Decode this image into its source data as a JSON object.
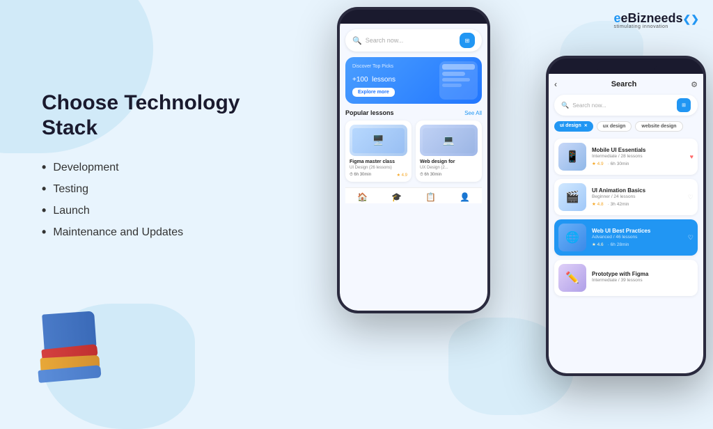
{
  "logo": {
    "brand": "eBizneeds",
    "subtitle": "stimulating innovation",
    "suffix": "❮❯"
  },
  "hero": {
    "title": "Choose Technology Stack"
  },
  "bullets": [
    {
      "text": "Development"
    },
    {
      "text": "Testing"
    },
    {
      "text": "Launch"
    },
    {
      "text": "Maintenance and Updates"
    }
  ],
  "phone1": {
    "search_placeholder": "Search now...",
    "hero_subtitle": "Discover Top Picks",
    "hero_count": "+100",
    "hero_count_label": "lessons",
    "hero_btn": "Explore more",
    "section_title": "Popular lessons",
    "see_all": "See All",
    "card1": {
      "title": "Figma master class",
      "subtitle": "UI Design (26 lessons)",
      "time": "6h 30min",
      "rating": "4.9"
    },
    "card2": {
      "title": "Web design for",
      "subtitle": "UX Design (2...",
      "time": "6h 30min",
      "rating": ""
    }
  },
  "phone2": {
    "header_title": "Search",
    "search_placeholder": "Search now...",
    "tags": [
      "ui design",
      "ux design",
      "website design"
    ],
    "courses": [
      {
        "title": "Mobile UI Essentials",
        "subtitle": "Intermediate / 28 lessons",
        "rating": "4.9",
        "duration": "6h 30min",
        "highlighted": false
      },
      {
        "title": "UI Animation Basics",
        "subtitle": "Beginner / 24 lessons",
        "rating": "4.8",
        "duration": "3h 42min",
        "highlighted": false
      },
      {
        "title": "Web UI Best Practices",
        "subtitle": "Advanced / 46 lessons",
        "rating": "4.6",
        "duration": "6h 28min",
        "highlighted": true
      },
      {
        "title": "Prototype with Figma",
        "subtitle": "Intermediate / 39 lessons",
        "rating": "",
        "duration": "",
        "highlighted": false
      }
    ]
  }
}
